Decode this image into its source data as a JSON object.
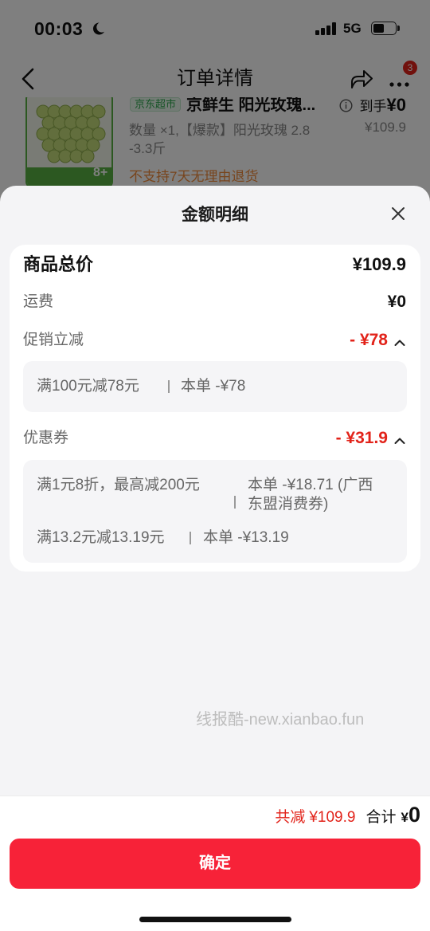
{
  "status_bar": {
    "time": "00:03",
    "network": "5G",
    "battery_level": 0.5,
    "icons": [
      "moon-icon",
      "signal-icon",
      "battery-icon"
    ]
  },
  "header": {
    "title": "订单详情",
    "more_badge": "3",
    "icons": {
      "back": "chevron-left-icon",
      "share": "share-icon",
      "more": "more-dots-icon"
    }
  },
  "order_item": {
    "store_tag": "京东超市",
    "title": "京鲜生 阳光玫瑰...",
    "final_label": "到手",
    "final_price": "¥0",
    "original_price": "¥109.9",
    "spec_line1": "数量 ×1,【爆款】阳光玫瑰 2.8",
    "spec_line2": "-3.3斤",
    "return_notice": "不支持7天无理由退货",
    "image_badge": "8+"
  },
  "price_detail": {
    "title": "金额明细",
    "goods_total": {
      "label": "商品总价",
      "value": "¥109.9"
    },
    "shipping": {
      "label": "运费",
      "value": "¥0"
    },
    "promotion": {
      "label": "促销立减",
      "value": "- ¥78",
      "expanded": true,
      "details": [
        {
          "rule": "满100元减78元",
          "applied": "本单 -¥78"
        }
      ]
    },
    "coupon": {
      "label": "优惠券",
      "value": "- ¥31.9",
      "expanded": true,
      "details": [
        {
          "rule": "满1元8折，最高减200元",
          "applied_line1": "本单 -¥18.71 (广西",
          "applied_line2": "东盟消费券)"
        },
        {
          "rule": "满13.2元减13.19元",
          "applied": "本单 -¥13.19"
        }
      ]
    }
  },
  "watermark": "线报酷-new.xianbao.fun",
  "footer": {
    "savings_label": "共减",
    "savings_amount": "¥109.9",
    "total_label": "合计",
    "total_currency": "¥",
    "total_amount": "0",
    "confirm_label": "确定"
  },
  "colors": {
    "accent_red": "#e2231a",
    "confirm_button": "#f72238",
    "store_tag_green": "#2fa84f",
    "notice_orange": "#f08a3a",
    "sheet_background": "#f4f4f6"
  }
}
